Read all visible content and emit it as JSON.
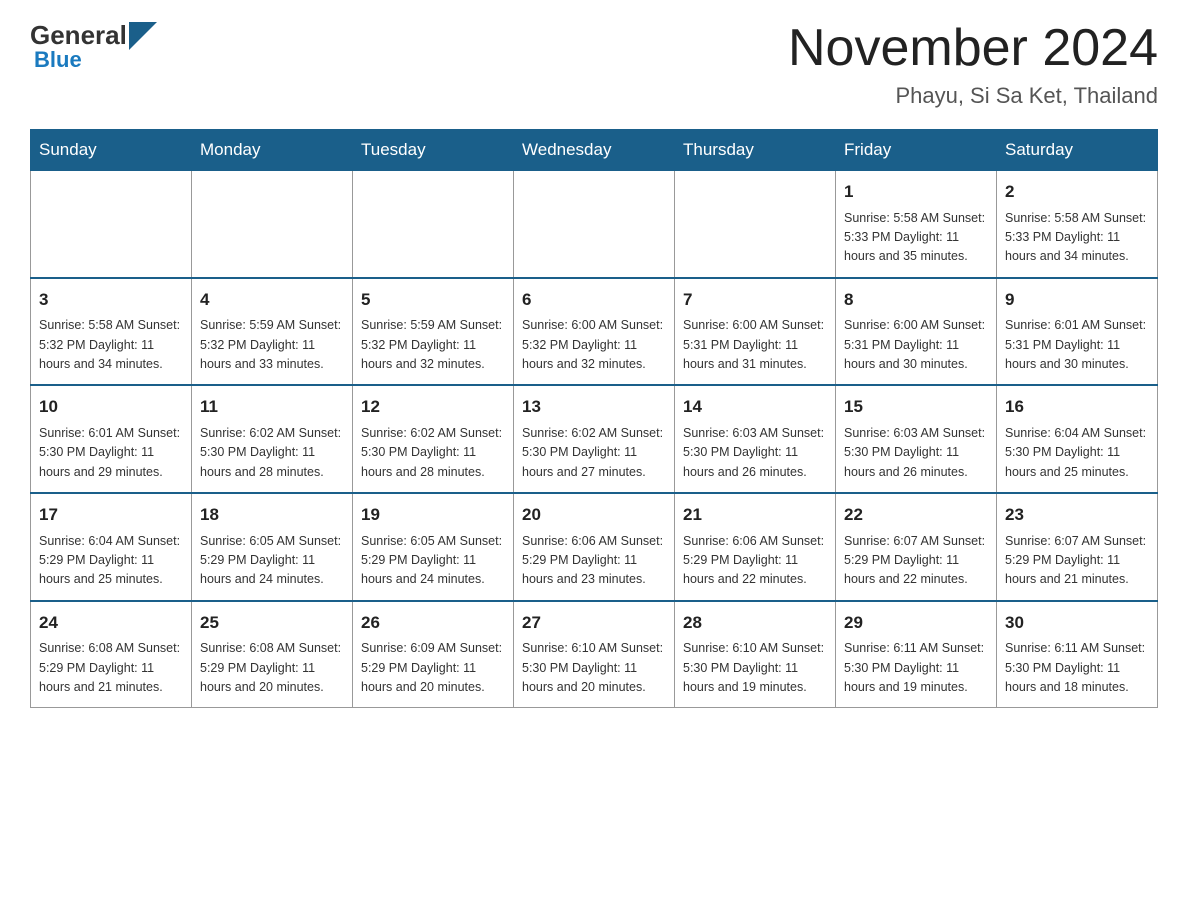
{
  "header": {
    "logo_general": "General",
    "logo_blue": "Blue",
    "month_title": "November 2024",
    "location": "Phayu, Si Sa Ket, Thailand"
  },
  "days_of_week": [
    "Sunday",
    "Monday",
    "Tuesday",
    "Wednesday",
    "Thursday",
    "Friday",
    "Saturday"
  ],
  "weeks": [
    [
      {
        "day": "",
        "info": ""
      },
      {
        "day": "",
        "info": ""
      },
      {
        "day": "",
        "info": ""
      },
      {
        "day": "",
        "info": ""
      },
      {
        "day": "",
        "info": ""
      },
      {
        "day": "1",
        "info": "Sunrise: 5:58 AM\nSunset: 5:33 PM\nDaylight: 11 hours\nand 35 minutes."
      },
      {
        "day": "2",
        "info": "Sunrise: 5:58 AM\nSunset: 5:33 PM\nDaylight: 11 hours\nand 34 minutes."
      }
    ],
    [
      {
        "day": "3",
        "info": "Sunrise: 5:58 AM\nSunset: 5:32 PM\nDaylight: 11 hours\nand 34 minutes."
      },
      {
        "day": "4",
        "info": "Sunrise: 5:59 AM\nSunset: 5:32 PM\nDaylight: 11 hours\nand 33 minutes."
      },
      {
        "day": "5",
        "info": "Sunrise: 5:59 AM\nSunset: 5:32 PM\nDaylight: 11 hours\nand 32 minutes."
      },
      {
        "day": "6",
        "info": "Sunrise: 6:00 AM\nSunset: 5:32 PM\nDaylight: 11 hours\nand 32 minutes."
      },
      {
        "day": "7",
        "info": "Sunrise: 6:00 AM\nSunset: 5:31 PM\nDaylight: 11 hours\nand 31 minutes."
      },
      {
        "day": "8",
        "info": "Sunrise: 6:00 AM\nSunset: 5:31 PM\nDaylight: 11 hours\nand 30 minutes."
      },
      {
        "day": "9",
        "info": "Sunrise: 6:01 AM\nSunset: 5:31 PM\nDaylight: 11 hours\nand 30 minutes."
      }
    ],
    [
      {
        "day": "10",
        "info": "Sunrise: 6:01 AM\nSunset: 5:30 PM\nDaylight: 11 hours\nand 29 minutes."
      },
      {
        "day": "11",
        "info": "Sunrise: 6:02 AM\nSunset: 5:30 PM\nDaylight: 11 hours\nand 28 minutes."
      },
      {
        "day": "12",
        "info": "Sunrise: 6:02 AM\nSunset: 5:30 PM\nDaylight: 11 hours\nand 28 minutes."
      },
      {
        "day": "13",
        "info": "Sunrise: 6:02 AM\nSunset: 5:30 PM\nDaylight: 11 hours\nand 27 minutes."
      },
      {
        "day": "14",
        "info": "Sunrise: 6:03 AM\nSunset: 5:30 PM\nDaylight: 11 hours\nand 26 minutes."
      },
      {
        "day": "15",
        "info": "Sunrise: 6:03 AM\nSunset: 5:30 PM\nDaylight: 11 hours\nand 26 minutes."
      },
      {
        "day": "16",
        "info": "Sunrise: 6:04 AM\nSunset: 5:30 PM\nDaylight: 11 hours\nand 25 minutes."
      }
    ],
    [
      {
        "day": "17",
        "info": "Sunrise: 6:04 AM\nSunset: 5:29 PM\nDaylight: 11 hours\nand 25 minutes."
      },
      {
        "day": "18",
        "info": "Sunrise: 6:05 AM\nSunset: 5:29 PM\nDaylight: 11 hours\nand 24 minutes."
      },
      {
        "day": "19",
        "info": "Sunrise: 6:05 AM\nSunset: 5:29 PM\nDaylight: 11 hours\nand 24 minutes."
      },
      {
        "day": "20",
        "info": "Sunrise: 6:06 AM\nSunset: 5:29 PM\nDaylight: 11 hours\nand 23 minutes."
      },
      {
        "day": "21",
        "info": "Sunrise: 6:06 AM\nSunset: 5:29 PM\nDaylight: 11 hours\nand 22 minutes."
      },
      {
        "day": "22",
        "info": "Sunrise: 6:07 AM\nSunset: 5:29 PM\nDaylight: 11 hours\nand 22 minutes."
      },
      {
        "day": "23",
        "info": "Sunrise: 6:07 AM\nSunset: 5:29 PM\nDaylight: 11 hours\nand 21 minutes."
      }
    ],
    [
      {
        "day": "24",
        "info": "Sunrise: 6:08 AM\nSunset: 5:29 PM\nDaylight: 11 hours\nand 21 minutes."
      },
      {
        "day": "25",
        "info": "Sunrise: 6:08 AM\nSunset: 5:29 PM\nDaylight: 11 hours\nand 20 minutes."
      },
      {
        "day": "26",
        "info": "Sunrise: 6:09 AM\nSunset: 5:29 PM\nDaylight: 11 hours\nand 20 minutes."
      },
      {
        "day": "27",
        "info": "Sunrise: 6:10 AM\nSunset: 5:30 PM\nDaylight: 11 hours\nand 20 minutes."
      },
      {
        "day": "28",
        "info": "Sunrise: 6:10 AM\nSunset: 5:30 PM\nDaylight: 11 hours\nand 19 minutes."
      },
      {
        "day": "29",
        "info": "Sunrise: 6:11 AM\nSunset: 5:30 PM\nDaylight: 11 hours\nand 19 minutes."
      },
      {
        "day": "30",
        "info": "Sunrise: 6:11 AM\nSunset: 5:30 PM\nDaylight: 11 hours\nand 18 minutes."
      }
    ]
  ]
}
